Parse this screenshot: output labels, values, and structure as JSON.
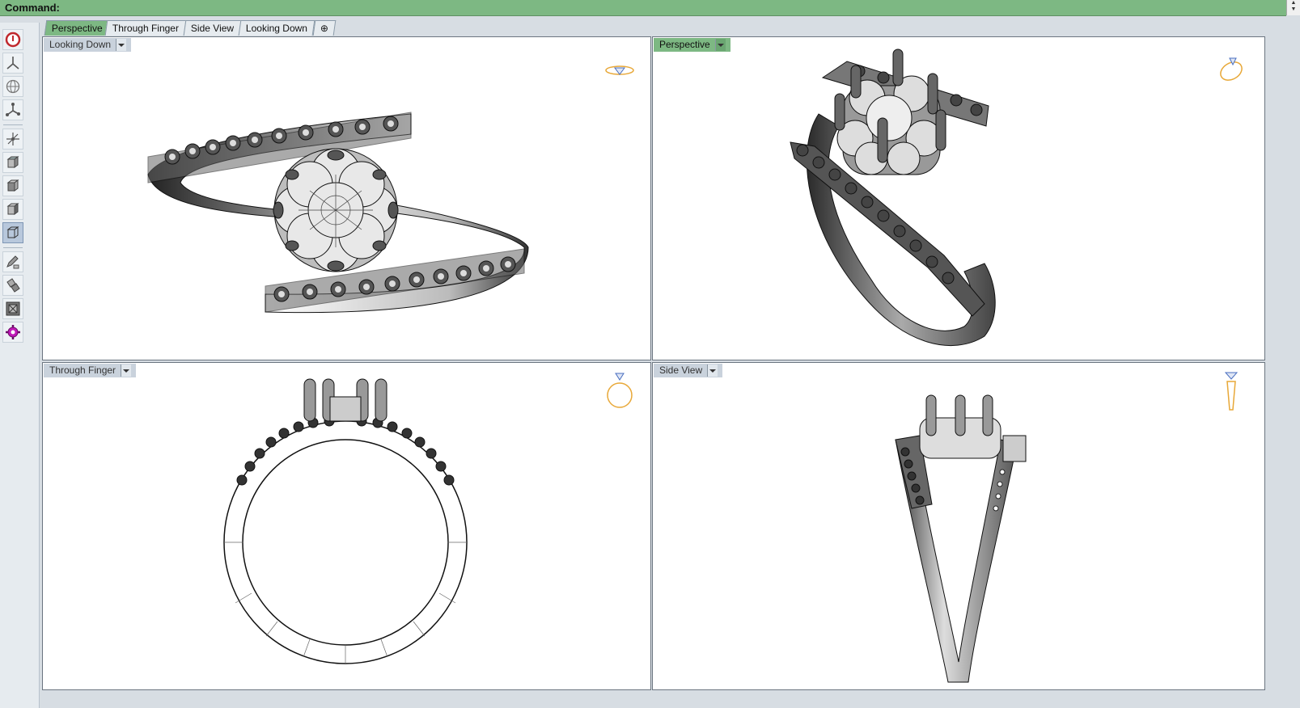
{
  "command": {
    "label": "Command:"
  },
  "tabs": [
    {
      "label": "Perspective",
      "active": true
    },
    {
      "label": "Through Finger",
      "active": false
    },
    {
      "label": "Side View",
      "active": false
    },
    {
      "label": "Looking Down",
      "active": false
    }
  ],
  "add_tab_icon": "plus-icon",
  "toolbar": {
    "tools": [
      "stop-icon",
      "tripod-icon",
      "globe-icon",
      "axes-icon",
      "axis-move-icon",
      "cube-view-icon",
      "cube-view-icon",
      "cube-view-icon",
      "cube-perspective-icon",
      "pencil-icon",
      "move-icon",
      "zoom-extents-icon",
      "gear-icon"
    ]
  },
  "viewports": {
    "top_left": {
      "label": "Looking Down",
      "active": false
    },
    "top_right": {
      "label": "Perspective",
      "active": true
    },
    "bottom_left": {
      "label": "Through Finger",
      "active": false
    },
    "bottom_right": {
      "label": "Side View",
      "active": false
    }
  },
  "colors": {
    "command_bg": "#7db883",
    "active_label": "#7db883",
    "nav_gold": "#e8a838",
    "nav_blue": "#4a6fc0"
  }
}
